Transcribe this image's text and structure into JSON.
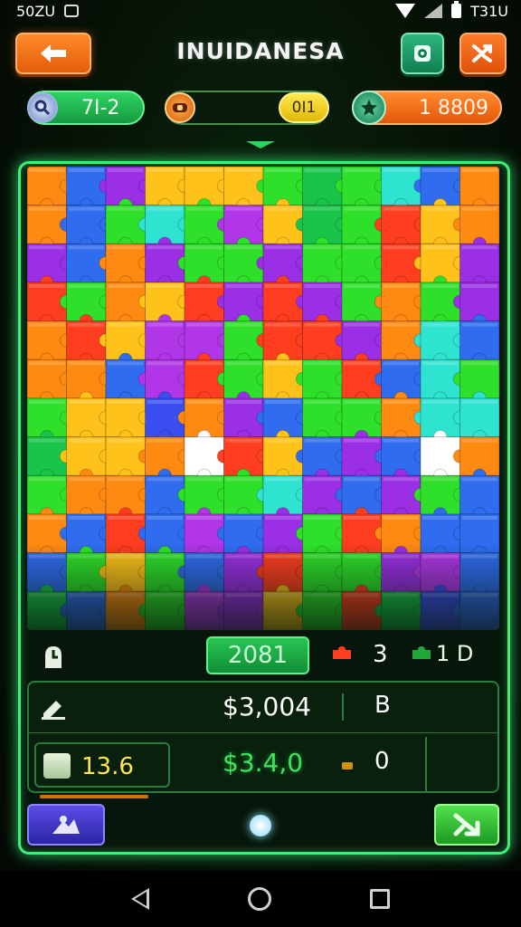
{
  "status_bar": {
    "left_text": "50ZU",
    "time": "T31U"
  },
  "header": {
    "title": "INUIDANESA"
  },
  "stats": {
    "left_value": "7I-2",
    "mid_badge": "0I1",
    "right_value": "1 8809"
  },
  "panel": {
    "timer": "2081",
    "count_a": "3",
    "count_b": "1 D",
    "money_primary": "$3,004",
    "label_b": "B",
    "level": "13.6",
    "money_secondary": "$3.4,0",
    "count_c": "0"
  },
  "icons": {
    "back": "arrow-left-icon",
    "settings": "gear-icon",
    "shuffle": "shuffle-icon",
    "search": "magnifier-icon",
    "coin": "coin-icon",
    "star": "star-icon",
    "timer": "timer-icon",
    "edit": "pencil-icon",
    "calendar": "calendar-icon",
    "hint": "hint-icon",
    "next": "arrow-next-icon"
  },
  "colors": {
    "accent_green": "#3cf07a",
    "orange": "#ff8a2a",
    "money_green": "#3fe25c",
    "yellow": "#ffe64a"
  },
  "board": {
    "rows": 12,
    "cols": 12,
    "palette": [
      "#ff8a12",
      "#2f6cf0",
      "#9b2fe6",
      "#ffc21a",
      "#2ee02a",
      "#ff3d1f",
      "#2ee3d0",
      "#19c44a",
      "#b036e8",
      "#3a4ef2"
    ],
    "grid": [
      [
        0,
        1,
        2,
        3,
        3,
        3,
        4,
        7,
        4,
        6,
        1,
        0
      ],
      [
        0,
        1,
        4,
        6,
        4,
        8,
        3,
        7,
        4,
        5,
        3,
        0
      ],
      [
        2,
        1,
        0,
        2,
        4,
        4,
        2,
        4,
        4,
        5,
        3,
        2
      ],
      [
        5,
        4,
        0,
        3,
        5,
        2,
        5,
        2,
        4,
        0,
        4,
        2
      ],
      [
        0,
        5,
        3,
        8,
        8,
        4,
        5,
        5,
        2,
        0,
        6,
        1
      ],
      [
        0,
        0,
        1,
        8,
        5,
        4,
        3,
        4,
        5,
        1,
        6,
        4
      ],
      [
        4,
        3,
        3,
        9,
        0,
        2,
        1,
        4,
        4,
        0,
        6,
        6
      ],
      [
        7,
        3,
        3,
        0,
        6,
        5,
        3,
        1,
        2,
        1,
        4,
        0
      ],
      [
        4,
        0,
        0,
        1,
        4,
        4,
        6,
        2,
        1,
        2,
        4,
        1
      ],
      [
        0,
        1,
        5,
        1,
        8,
        1,
        2,
        4,
        5,
        0,
        1,
        1
      ],
      [
        1,
        4,
        3,
        4,
        1,
        2,
        5,
        4,
        4,
        2,
        8,
        1
      ],
      [
        7,
        1,
        0,
        4,
        8,
        2,
        3,
        4,
        5,
        7,
        9,
        1
      ]
    ],
    "empty_slots": [
      [
        7,
        4
      ],
      [
        7,
        10
      ]
    ]
  }
}
